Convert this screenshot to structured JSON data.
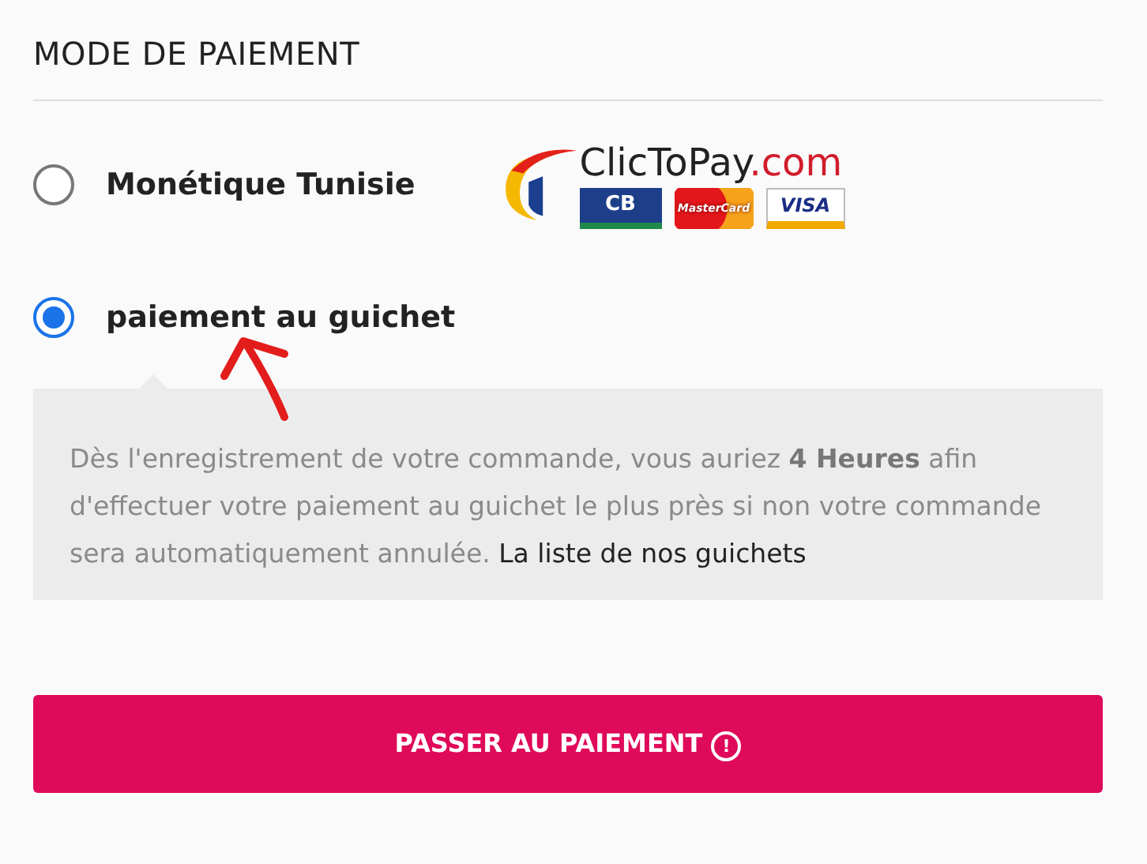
{
  "section_title": "MODE DE PAIEMENT",
  "options": [
    {
      "label": "Monétique Tunisie",
      "selected": false,
      "logo": {
        "brand": "ClicToPay",
        "domain": ".com",
        "cards": [
          "CB",
          "MasterCard",
          "VISA"
        ]
      }
    },
    {
      "label": "paiement au guichet",
      "selected": true,
      "info": {
        "text": "Dès l'enregistrement de votre commande, vous auriez **4 Heures** afin d'effectuer votre paiement au guichet le plus près si non votre commande sera automatiquement annulée.",
        "link": "La liste de nos guichets"
      }
    }
  ],
  "submit": {
    "label": "PASSER AU PAIEMENT",
    "icon": "!"
  }
}
